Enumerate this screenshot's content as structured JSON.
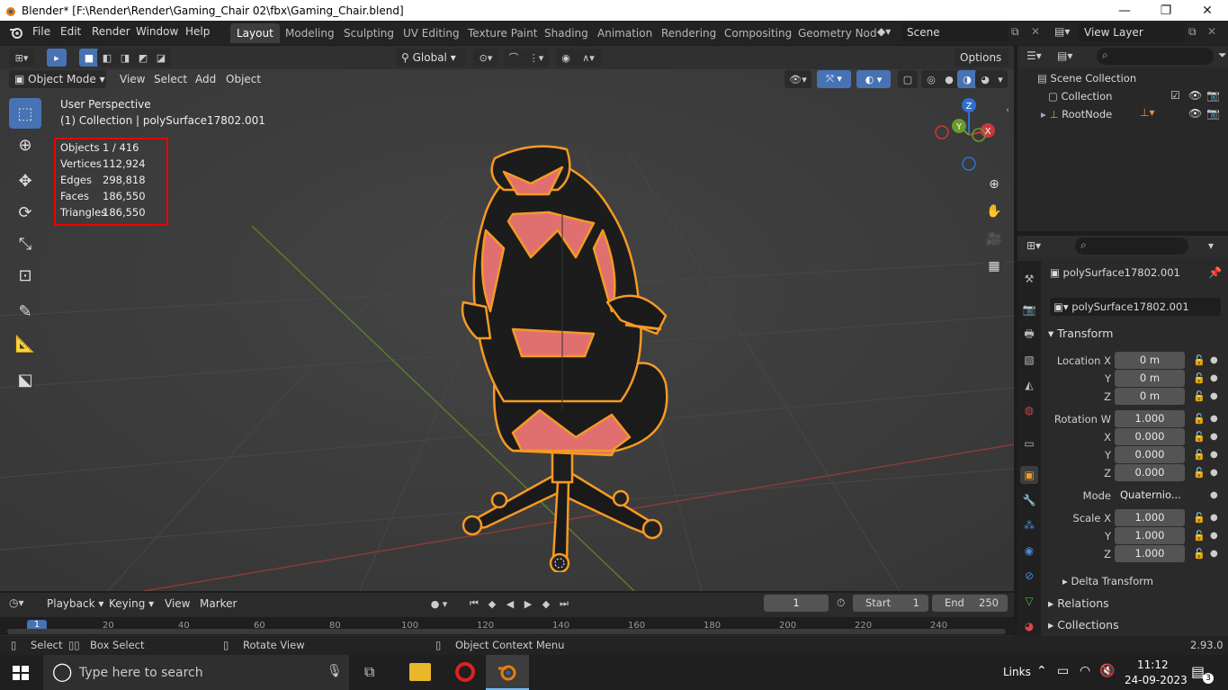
{
  "window": {
    "title": "Blender* [F:\\Render\\Render\\Gaming_Chair 02\\fbx\\Gaming_Chair.blend]",
    "minimize": "—",
    "restore": "❐",
    "close": "✕"
  },
  "menu": [
    "File",
    "Edit",
    "Render",
    "Window",
    "Help"
  ],
  "workspaces": [
    "Layout",
    "Modeling",
    "Sculpting",
    "UV Editing",
    "Texture Paint",
    "Shading",
    "Animation",
    "Rendering",
    "Compositing",
    "Geometry Nod"
  ],
  "scene": "Scene",
  "view_layer": "View Layer",
  "viewport": {
    "mode": "Object Mode",
    "menus": [
      "View",
      "Select",
      "Add",
      "Object"
    ],
    "orientation": "Global",
    "options": "Options",
    "overlay_title": "User Perspective",
    "overlay_sub": "(1) Collection | polySurface17802.001",
    "stats": [
      [
        "Objects",
        "1 / 416"
      ],
      [
        "Vertices",
        "112,924"
      ],
      [
        "Edges",
        "298,818"
      ],
      [
        "Faces",
        "186,550"
      ],
      [
        "Triangles",
        "186,550"
      ]
    ],
    "gizmo": {
      "z": "Z",
      "y": "Y",
      "x": "X"
    }
  },
  "outliner": {
    "root": "Scene Collection",
    "collection": "Collection",
    "node": "RootNode"
  },
  "properties": {
    "object": "polySurface17802.001",
    "datablock": "polySurface17802.001",
    "panel": "Transform",
    "location": {
      "label": "Location X",
      "x": "0 m",
      "y": "0 m",
      "z": "0 m"
    },
    "rotation": {
      "label": "Rotation W",
      "w": "1.000",
      "x": "0.000",
      "y": "0.000",
      "z": "0.000"
    },
    "mode_label": "Mode",
    "mode": "Quaternio...",
    "scale": {
      "label": "Scale X",
      "x": "1.000",
      "y": "1.000",
      "z": "1.000"
    },
    "axis": {
      "y": "Y",
      "z": "Z",
      "x": "X"
    },
    "delta": "Delta Transform",
    "relations": "Relations",
    "collections": "Collections"
  },
  "timeline": {
    "menus": [
      "Playback",
      "Keying",
      "View",
      "Marker"
    ],
    "frame": "1",
    "start_label": "Start",
    "start": "1",
    "end_label": "End",
    "end": "250",
    "ruler": [
      "1",
      "20",
      "40",
      "60",
      "80",
      "100",
      "120",
      "140",
      "160",
      "180",
      "200",
      "220",
      "240"
    ]
  },
  "status": {
    "select": "Select",
    "box": "Box Select",
    "rotate": "Rotate View",
    "context": "Object Context Menu",
    "version": "2.93.0"
  },
  "taskbar": {
    "search": "Type here to search",
    "links": "Links",
    "time": "11:12",
    "date": "24-09-2023",
    "notif": "3"
  },
  "colors": {
    "accent": "#4772b3",
    "selection": "#f59a23",
    "stats_border": "#e00000"
  }
}
